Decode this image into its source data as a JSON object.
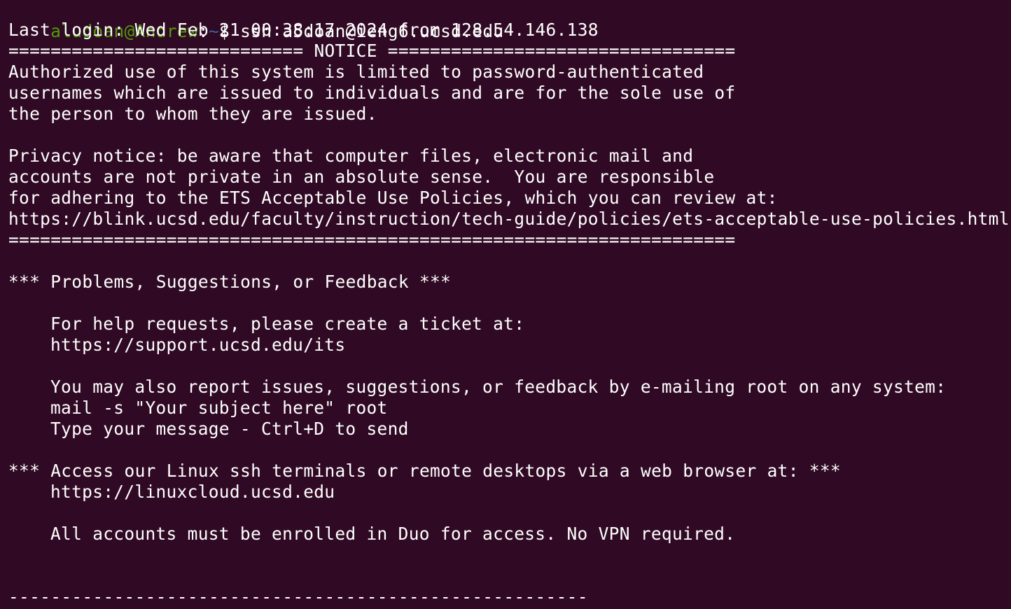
{
  "terminal": {
    "background": "#300a24",
    "foreground": "#ffffff",
    "prompt": {
      "user_host": "aludoan@Andrew",
      "colon": ":",
      "path": "~",
      "dollar": "$",
      "command": " ssh a5doan@ieng6.ucsd.edu",
      "user_host_color": "#4e9a06",
      "path_color": "#3465a4"
    },
    "lines": [
      "Last login: Wed Feb 21 00:38:17 2024 from 128.54.146.138",
      "============================ NOTICE =================================",
      "Authorized use of this system is limited to password-authenticated",
      "usernames which are issued to individuals and are for the sole use of",
      "the person to whom they are issued.",
      "Privacy notice: be aware that computer files, electronic mail and",
      "accounts are not private in an absolute sense.  You are responsible",
      "for adhering to the ETS Acceptable Use Policies, which you can review at:",
      "https://blink.ucsd.edu/faculty/instruction/tech-guide/policies/ets-acceptable-use-policies.html",
      "=====================================================================",
      "*** Problems, Suggestions, or Feedback ***",
      "For help requests, please create a ticket at:",
      "https://support.ucsd.edu/its",
      "You may also report issues, suggestions, or feedback by e-mailing root on any system:",
      "mail -s \"Your subject here\" root",
      "Type your message - Ctrl+D to send",
      "*** Access our Linux ssh terminals or remote desktops via a web browser at: ***",
      "https://linuxcloud.ucsd.edu",
      "All accounts must be enrolled in Duo for access. No VPN required.",
      "-------------------------------------------------------"
    ]
  }
}
